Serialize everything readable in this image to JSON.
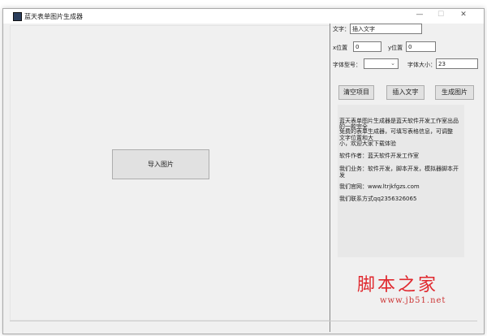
{
  "window": {
    "title": "蓝天表单图片生成器",
    "minimize": "—",
    "maximize": "☐",
    "close": "✕"
  },
  "left": {
    "import_button": "导入图片"
  },
  "right": {
    "text_label": "文字：",
    "text_value": "插入文字",
    "x_label": "x位置",
    "x_value": "0",
    "y_label": "y位置",
    "y_value": "0",
    "font_type_label": "字体型号：",
    "font_type_value": "",
    "font_size_label": "字体大小：",
    "font_size_value": "23",
    "clear_button": "清空项目",
    "insert_button": "插入文字",
    "generate_button": "生成图片"
  },
  "info": {
    "line1": "蓝天表单图片生成器是蓝天软件开发工作室出品",
    "line2": "的一款完全",
    "line3": "免费的表单生成器，可填写表格信息，可调整",
    "line4": "文字位置和大",
    "line5": "小，欢迎大家下载体验",
    "author": "软件作者：蓝天软件开发工作室",
    "business1": "我们业务：软件开发，脚本开发，模拟器脚本开",
    "business2": "发",
    "website": "我们官网：www.ltrjkfgzs.com",
    "contact": "我们联系方式qq2356326065"
  },
  "watermark": {
    "title": "脚本之家",
    "url": "www.jb51.net"
  }
}
